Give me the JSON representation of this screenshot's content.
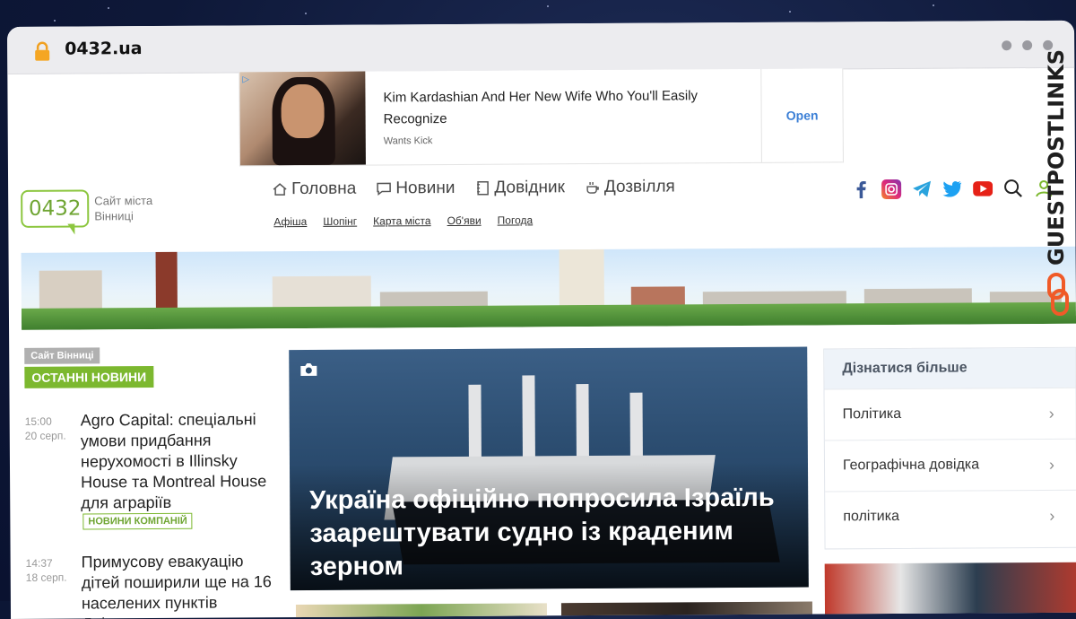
{
  "browser": {
    "url": "0432.ua"
  },
  "ad": {
    "title": "Kim Kardashian And Her New Wife Who You'll Easily Recognize",
    "source": "Wants Kick",
    "cta": "Open"
  },
  "logo": {
    "number": "0432",
    "tagline": "Сайт міста Вінниці"
  },
  "nav": {
    "main": [
      {
        "label": "Головна",
        "icon": "home-icon"
      },
      {
        "label": "Новини",
        "icon": "chat-icon"
      },
      {
        "label": "Довідник",
        "icon": "book-icon"
      },
      {
        "label": "Дозвілля",
        "icon": "cup-icon"
      }
    ],
    "sub": [
      "Афіша",
      "Шопінг",
      "Карта міста",
      "Об'яви",
      "Погода"
    ]
  },
  "social": [
    "facebook-icon",
    "instagram-icon",
    "telegram-icon",
    "twitter-icon",
    "youtube-icon",
    "search-icon",
    "user-icon"
  ],
  "latest": {
    "site_label": "Сайт Вінниці",
    "heading": "ОСТАННІ НОВИНИ",
    "items": [
      {
        "time": "15:00",
        "date": "20 серп.",
        "title": "Agro Capital: спеціальні умови придбання нерухомості в Illinsky House та Montreal House для аграріїв",
        "category": "НОВИНИ КОМПАНІЙ"
      },
      {
        "time": "14:37",
        "date": "18 серп.",
        "title": "Примусову евакуацію дітей поширили ще на 16 населених пунктів Дніпропетровщини",
        "category": ""
      }
    ]
  },
  "hero": {
    "title": "Україна офіційно попросила Ізраїль заарештувати судно із краденим зерном"
  },
  "side": {
    "heading": "Дізнатися більше",
    "items": [
      "Політика",
      "Географічна довідка",
      "політика"
    ]
  },
  "watermark": {
    "text": "GUESTPOSTLINKS"
  },
  "colors": {
    "brand_green": "#7cb82f",
    "accent_blue": "#3b7fd6"
  }
}
